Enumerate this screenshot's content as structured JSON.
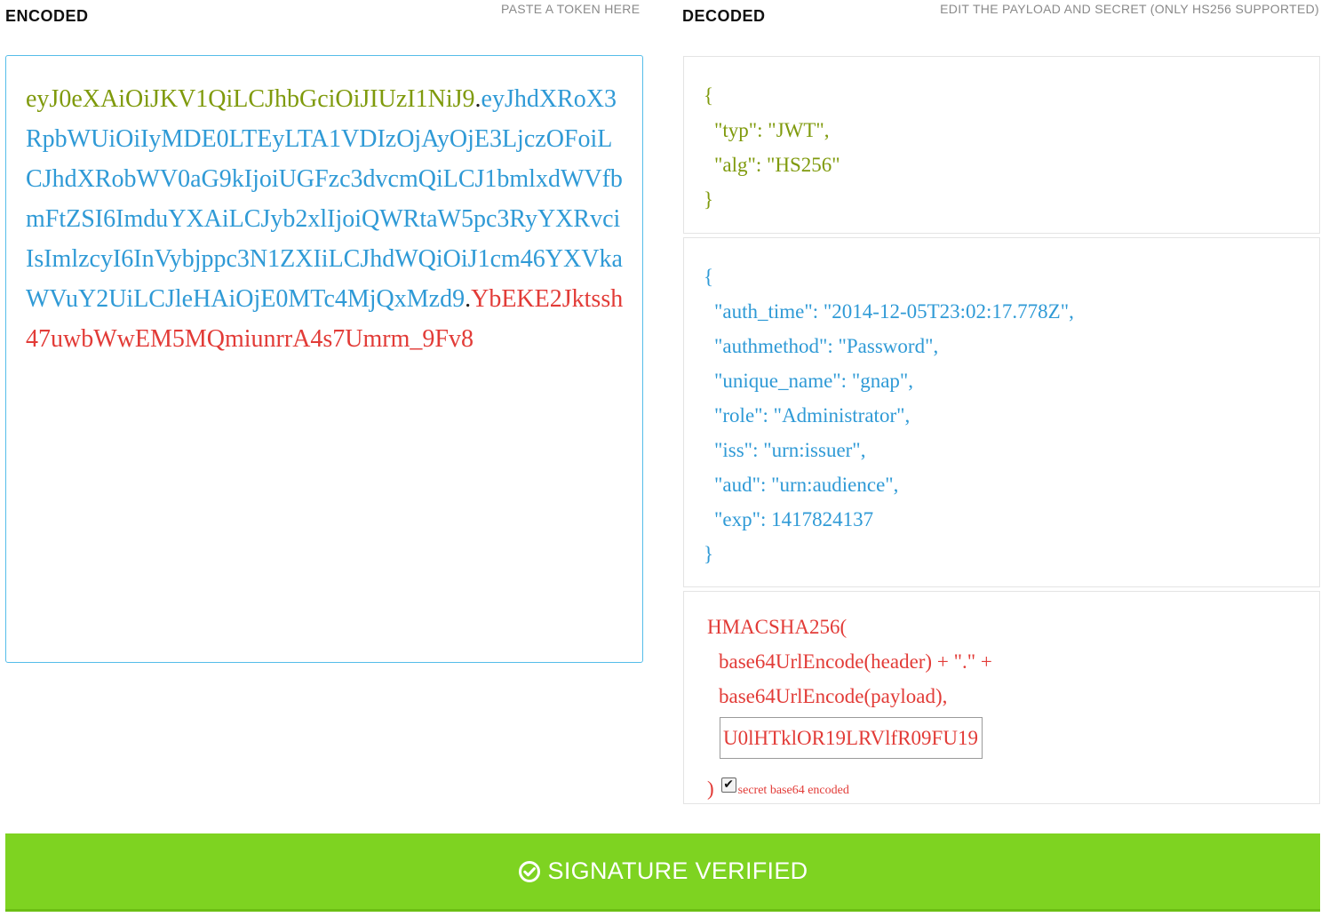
{
  "encoded": {
    "heading": "ENCODED",
    "hint": "PASTE A TOKEN HERE",
    "token_header": "eyJ0eXAiOiJKV1QiLCJhbGciOiJIUzI1NiJ9",
    "dot1": ".",
    "token_payload": "eyJhdXRoX3RpbWUiOiIyMDE0LTEyLTA1VDIzOjAyOjE3LjczOFoiLCJhdXRobWV0aG9kIjoiUGFzc3dvcmQiLCJ1bmlxdWVfbmFtZSI6ImduYXAiLCJyb2xlIjoiQWRtaW5pc3RyYXRvciIsImlzcyI6InVybjppc3N1ZXIiLCJhdWQiOiJ1cm46YXVkaWVuY2UiLCJleHAiOjE0MTc4MjQxMzd9",
    "dot2": ".",
    "token_signature": "YbEKE2Jktssh47uwbWwEM5MQmiunrrA4s7Umrm_9Fv8"
  },
  "decoded": {
    "heading": "DECODED",
    "hint": "EDIT THE PAYLOAD AND SECRET (ONLY HS256 SUPPORTED)",
    "header_json": {
      "open": "{",
      "typ": "\"typ\": \"JWT\",",
      "alg": "\"alg\": \"HS256\"",
      "close": "}"
    },
    "payload_json": {
      "open": "{",
      "auth_time": "\"auth_time\": \"2014-12-05T23:02:17.778Z\",",
      "authmethod": "\"authmethod\": \"Password\",",
      "unique_name": "\"unique_name\": \"gnap\",",
      "role": "\"role\": \"Administrator\",",
      "iss": "\"iss\": \"urn:issuer\",",
      "aud": "\"aud\": \"urn:audience\",",
      "exp": "\"exp\": 1417824137",
      "close": "}"
    },
    "signature": {
      "fn_open": "HMACSHA256(",
      "line_header": "base64UrlEncode(header) + \".\" +",
      "line_payload": "base64UrlEncode(payload),",
      "secret_value": "U0lHTklOR19LRVlfR09FU19",
      "fn_close": ")",
      "checkbox_checked": true,
      "checkbox_label": "secret base64 encoded"
    }
  },
  "status": {
    "label": "SIGNATURE VERIFIED",
    "icon": "check-circle-icon",
    "color": "#7ed321"
  },
  "colors": {
    "header": "#7f9a0c",
    "payload": "#2f9ad6",
    "signature": "#e23b37",
    "accent_border": "#55bde9"
  }
}
